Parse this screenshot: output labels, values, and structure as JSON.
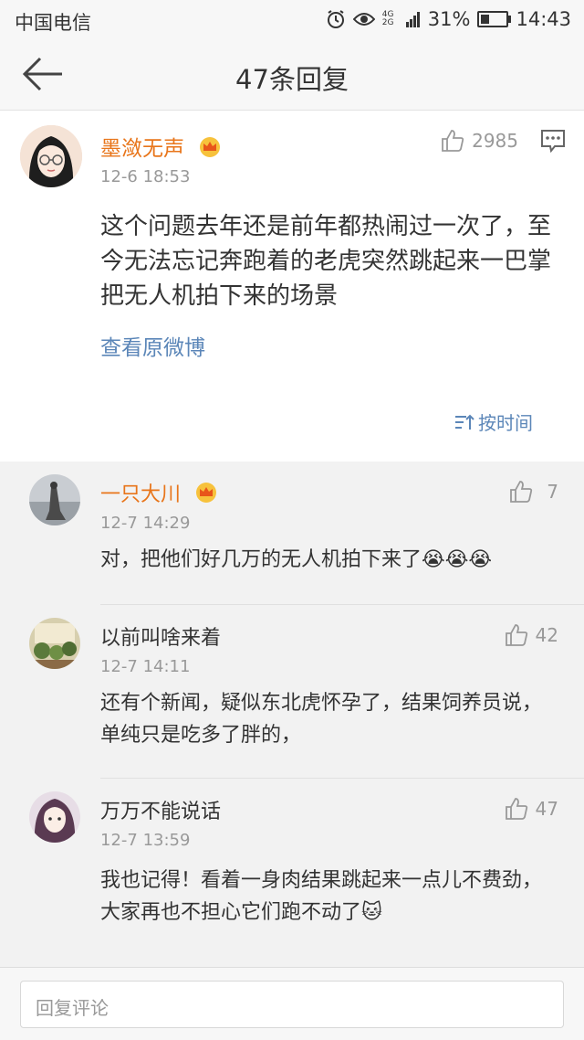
{
  "status": {
    "carrier": "中国电信",
    "network": "4G 2G",
    "battery": "31%",
    "time": "14:43"
  },
  "header": {
    "title": "47条回复"
  },
  "main_comment": {
    "author": "墨潋无声",
    "time": "12-6 18:53",
    "likes": "2985",
    "text": "这个问题去年还是前年都热闹过一次了，至今无法忘记奔跑着的老虎突然跳起来一巴掌把无人机拍下来的场景",
    "view_original": "查看原微博",
    "sort_label": "按时间"
  },
  "replies": [
    {
      "author": "一只大川",
      "time": "12-7 14:29",
      "likes": "7",
      "text": "对，把他们好几万的无人机拍下来了😭😭😭",
      "vip": true
    },
    {
      "author": "以前叫啥来着",
      "time": "12-7 14:11",
      "likes": "42",
      "text": "还有个新闻，疑似东北虎怀孕了，结果饲养员说，单纯只是吃多了胖的，",
      "vip": false
    },
    {
      "author": "万万不能说话",
      "time": "12-7 13:59",
      "likes": "47",
      "text": "我也记得！看着一身肉结果跳起来一点儿不费劲，大家再也不担心它们跑不动了🐱",
      "vip": false
    }
  ],
  "bottom": {
    "placeholder": "回复评论"
  },
  "colors": {
    "vip_name": "#e8751a",
    "link": "#5b86b8",
    "muted": "#999999"
  }
}
